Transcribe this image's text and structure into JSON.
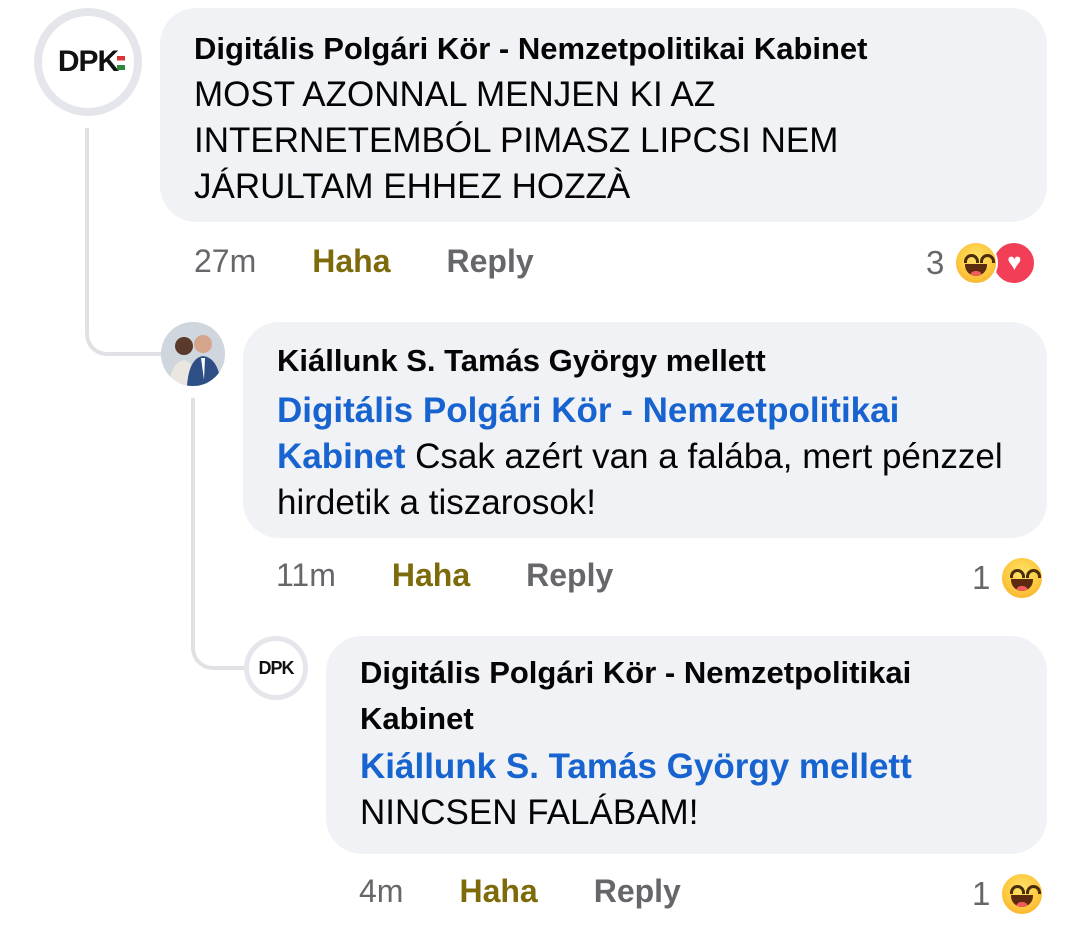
{
  "comments": [
    {
      "author": "Digitális Polgári Kör - Nemzetpolitikai Kabinet",
      "avatar_text": "DPK",
      "mention": "",
      "text_lines": [
        "MOST AZONNAL MENJEN KI AZ",
        "INTERNETEMBÓL PIMASZ LIPCSI NEM",
        "JÁRULTAM EHHEZ HOZZÀ"
      ],
      "time": "27m",
      "haha_label": "Haha",
      "reply_label": "Reply",
      "reaction_count": "3",
      "reactions": [
        "haha-icon",
        "love-icon"
      ]
    },
    {
      "author": "Kiállunk S. Tamás György mellett",
      "avatar_text": "",
      "mention": "Digitális Polgári Kör - Nemzetpolitikai Kabinet",
      "text": "Csak azért van a falába, mert pénzzel hirdetik a tiszarosok!",
      "time": "11m",
      "haha_label": "Haha",
      "reply_label": "Reply",
      "reaction_count": "1",
      "reactions": [
        "haha-icon"
      ]
    },
    {
      "author": "Digitális Polgári Kör - Nemzetpolitikai Kabinet",
      "avatar_text": "DPK",
      "mention": "Kiállunk S. Tamás György mellett",
      "text": "NINCSEN FALÁBAM!",
      "time": "4m",
      "haha_label": "Haha",
      "reply_label": "Reply",
      "reaction_count": "1",
      "reactions": [
        "haha-icon"
      ]
    }
  ],
  "colors": {
    "bubble": "#f0f2f5",
    "mention": "#1763cf",
    "haha_active": "#7d6a0b",
    "muted": "#65676b"
  }
}
